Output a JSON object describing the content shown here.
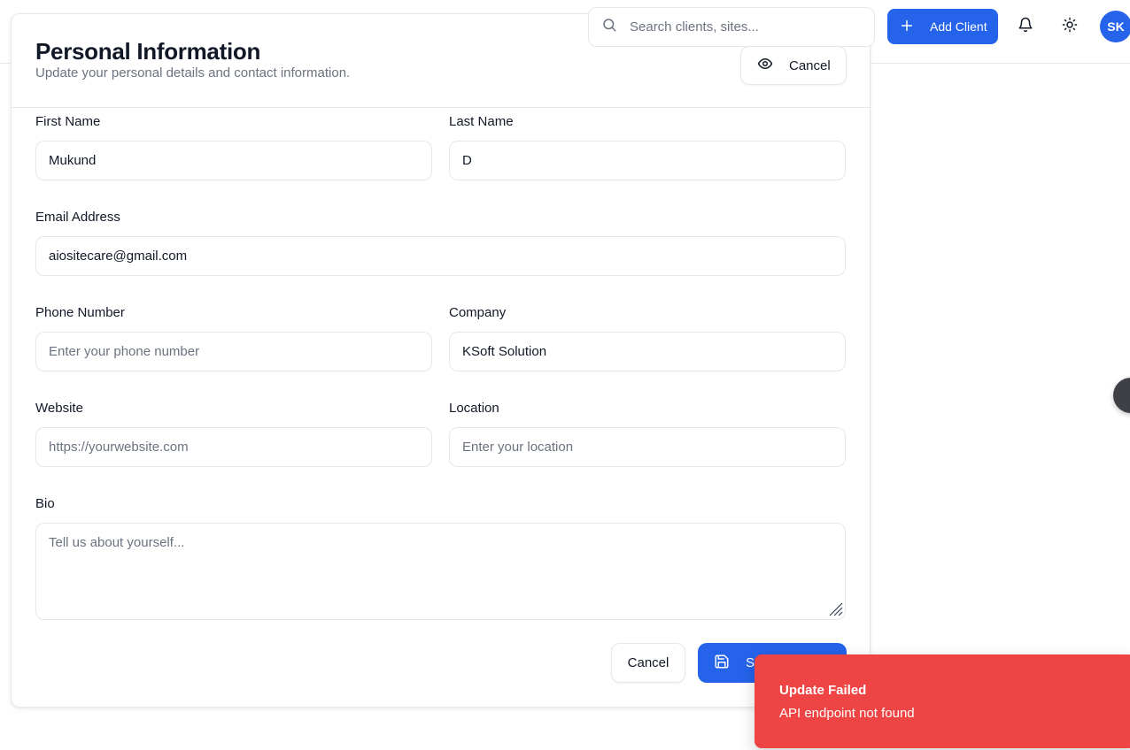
{
  "header": {
    "search_placeholder": "Search clients, sites...",
    "add_client_label": "Add Client",
    "avatar_initials": "SK"
  },
  "card": {
    "title": "Personal Information",
    "subtitle": "Update your personal details and contact information.",
    "preview_button_label": "Cancel"
  },
  "form": {
    "first_name": {
      "label": "First Name",
      "value": "Mukund",
      "placeholder": ""
    },
    "last_name": {
      "label": "Last Name",
      "value": "D",
      "placeholder": ""
    },
    "email": {
      "label": "Email Address",
      "value": "aiositecare@gmail.com",
      "placeholder": ""
    },
    "phone": {
      "label": "Phone Number",
      "value": "",
      "placeholder": "Enter your phone number"
    },
    "company": {
      "label": "Company",
      "value": "KSoft Solution",
      "placeholder": ""
    },
    "website": {
      "label": "Website",
      "value": "",
      "placeholder": "https://yourwebsite.com"
    },
    "location": {
      "label": "Location",
      "value": "",
      "placeholder": "Enter your location"
    },
    "bio": {
      "label": "Bio",
      "value": "",
      "placeholder": "Tell us about yourself..."
    }
  },
  "actions": {
    "cancel_label": "Cancel",
    "save_label": "Sa"
  },
  "toast": {
    "title": "Update Failed",
    "message": "API endpoint not found"
  },
  "colors": {
    "primary": "#2563eb",
    "error": "#ef4444",
    "border": "#e5e7eb",
    "muted_text": "#6b7280"
  }
}
